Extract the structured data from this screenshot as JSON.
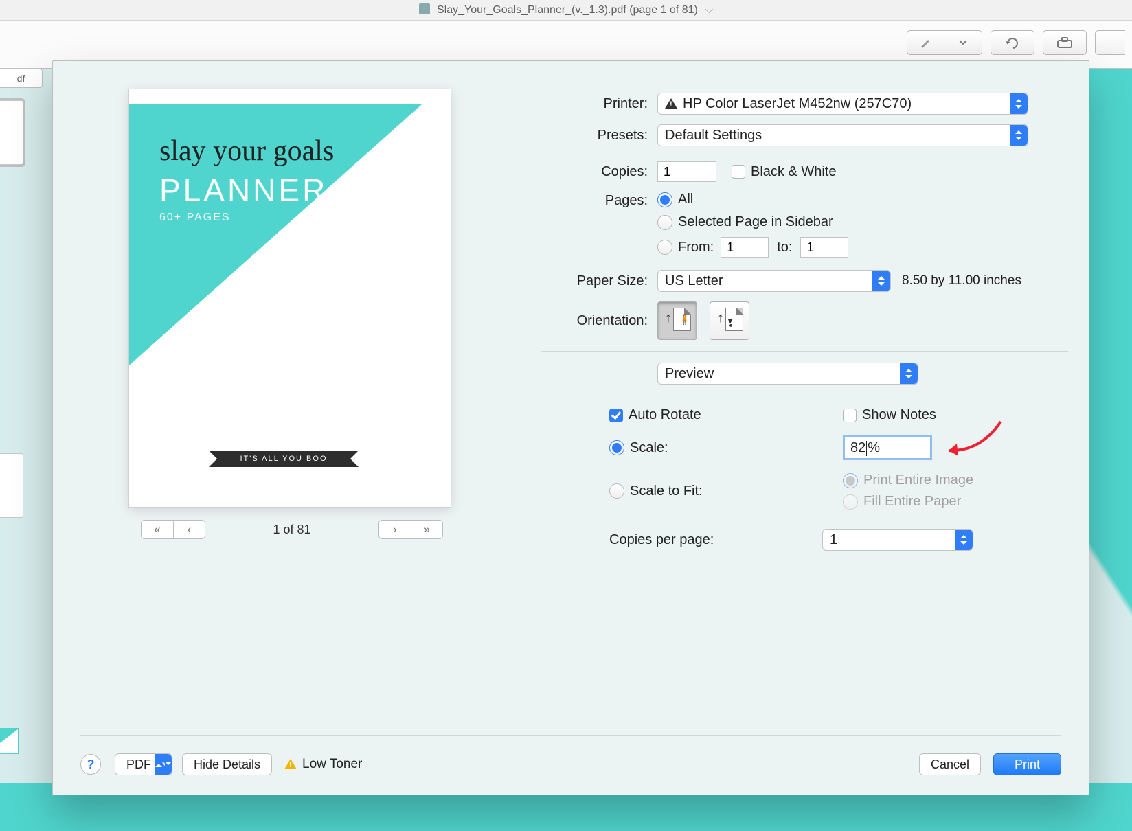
{
  "window": {
    "title": "Slay_Your_Goals_Planner_(v._1.3).pdf (page 1 of 81)",
    "pdf_tab": "df"
  },
  "preview": {
    "cover_script": "slay your goals",
    "cover_title": "PLANNER",
    "cover_sub": "60+ PAGES",
    "ribbon": "IT'S ALL YOU BOO",
    "page_counter": "1 of 81"
  },
  "form": {
    "printer_label": "Printer:",
    "printer_value": "HP Color LaserJet M452nw (257C70)",
    "presets_label": "Presets:",
    "presets_value": "Default Settings",
    "copies_label": "Copies:",
    "copies_value": "1",
    "bw_label": "Black & White",
    "pages_label": "Pages:",
    "pages_all": "All",
    "pages_selected": "Selected Page in Sidebar",
    "pages_from": "From:",
    "pages_from_v": "1",
    "pages_to": "to:",
    "pages_to_v": "1",
    "papersize_label": "Paper Size:",
    "papersize_value": "US Letter",
    "papersize_dim": "8.50 by 11.00 inches",
    "orientation_label": "Orientation:",
    "section_value": "Preview",
    "auto_rotate": "Auto Rotate",
    "show_notes": "Show Notes",
    "scale_label": "Scale:",
    "scale_value_a": "82",
    "scale_value_b": "%",
    "scale_fit": "Scale to Fit:",
    "print_entire": "Print Entire Image",
    "fill_entire": "Fill Entire Paper",
    "copies_pp_label": "Copies per page:",
    "copies_pp_value": "1"
  },
  "footer": {
    "help": "?",
    "pdf": "PDF",
    "hide_details": "Hide Details",
    "low_toner": "Low Toner",
    "cancel": "Cancel",
    "print": "Print"
  }
}
